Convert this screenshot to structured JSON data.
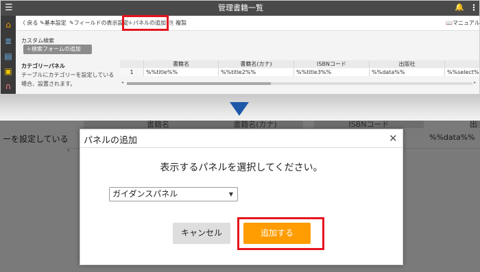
{
  "app": {
    "title": "管理書籍一覧"
  },
  "colors": {
    "accent_orange": "#ff9c00",
    "highlight_red": "#e5121c",
    "arrow_blue": "#1e57a8",
    "titlebar": "#4a4a4a"
  },
  "icons": {
    "menu": "hamburger-icon",
    "bell": "bell-icon",
    "kebab": "kebab-icon"
  },
  "glyphs": {
    "menu": "☰",
    "bell": "🔔",
    "kebab": "⋮",
    "home": "⌂",
    "db": "≣",
    "chat": "▤",
    "gift": "▣",
    "head": "∩",
    "close": "✕",
    "caret": "▼",
    "left": "◂",
    "right": "▸"
  },
  "toolbar": {
    "back": "〈 戻る",
    "basic_settings": "✎基本設定",
    "field_display": "✎フィールドの表示設定",
    "add_panel": "＋パネルの追加",
    "copy": "⎘ 複製",
    "manual": "📖マニュアル"
  },
  "custom_search": {
    "label": "カスタム検索",
    "add_button": "＋検索フォームの追加"
  },
  "category_panel": {
    "title": "カテゴリーパネル",
    "description": "テーブルにカテゴリーを設定している場合、設置されます。"
  },
  "grid": {
    "headers": [
      "書籍名",
      "書籍名(カナ)",
      "ISBNコード",
      "出版社",
      ""
    ],
    "row": {
      "index": "1",
      "cells": [
        "%%title%%",
        "%%title2%%",
        "%%title3%%",
        "%%data%%",
        "%%select%%"
      ]
    }
  },
  "background": {
    "headers": [
      "書籍名",
      "書籍名(カナ)",
      "ISBNコード",
      "出"
    ],
    "left_text": "ーを設定している",
    "data_text": "%%data%%"
  },
  "dialog": {
    "title": "パネルの追加",
    "message": "表示するパネルを選択してください。",
    "select_value": "ガイダンスパネル",
    "cancel": "キャンセル",
    "add": "追加する"
  }
}
